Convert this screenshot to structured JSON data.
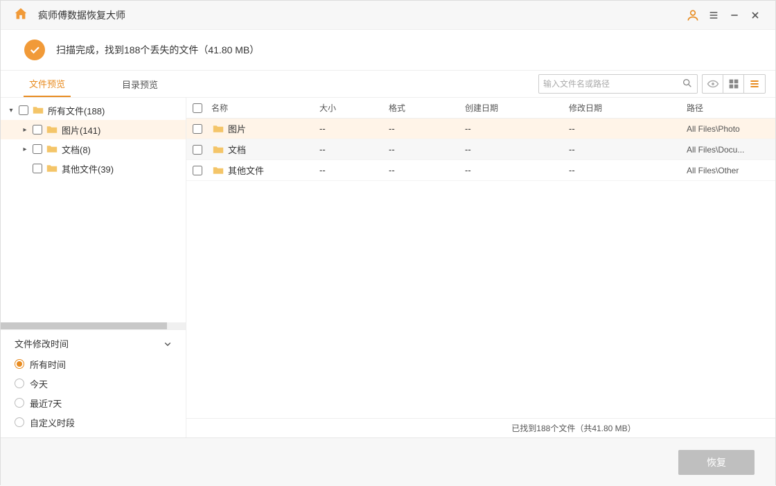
{
  "app": {
    "title": "疯师傅数据恢复大师"
  },
  "status": {
    "text": "扫描完成，找到188个丢失的文件（41.80 MB）"
  },
  "tabs": {
    "file_preview": "文件预览",
    "dir_preview": "目录预览"
  },
  "search": {
    "placeholder": "输入文件名或路径"
  },
  "tree": [
    {
      "label": "所有文件(188)",
      "indent": 0,
      "expanded": true,
      "selected": false
    },
    {
      "label": "图片(141)",
      "indent": 1,
      "expanded": false,
      "hasChildren": true,
      "selected": true
    },
    {
      "label": "文档(8)",
      "indent": 1,
      "expanded": false,
      "hasChildren": true,
      "selected": false
    },
    {
      "label": "其他文件(39)",
      "indent": 1,
      "expanded": false,
      "hasChildren": false,
      "selected": false
    }
  ],
  "filter": {
    "title": "文件修改时间",
    "options": [
      "所有时间",
      "今天",
      "最近7天",
      "自定义时段"
    ],
    "selected": 0
  },
  "columns": {
    "name": "名称",
    "size": "大小",
    "format": "格式",
    "created": "创建日期",
    "modified": "修改日期",
    "path": "路径"
  },
  "rows": [
    {
      "name": "图片",
      "size": "--",
      "format": "--",
      "created": "--",
      "modified": "--",
      "path": "All Files\\Photo",
      "selected": true
    },
    {
      "name": "文档",
      "size": "--",
      "format": "--",
      "created": "--",
      "modified": "--",
      "path": "All Files\\Docu...",
      "alt": true
    },
    {
      "name": "其他文件",
      "size": "--",
      "format": "--",
      "created": "--",
      "modified": "--",
      "path": "All Files\\Other"
    }
  ],
  "statusbar": {
    "text": "已找到188个文件（共41.80 MB）"
  },
  "footer": {
    "recover": "恢复"
  }
}
